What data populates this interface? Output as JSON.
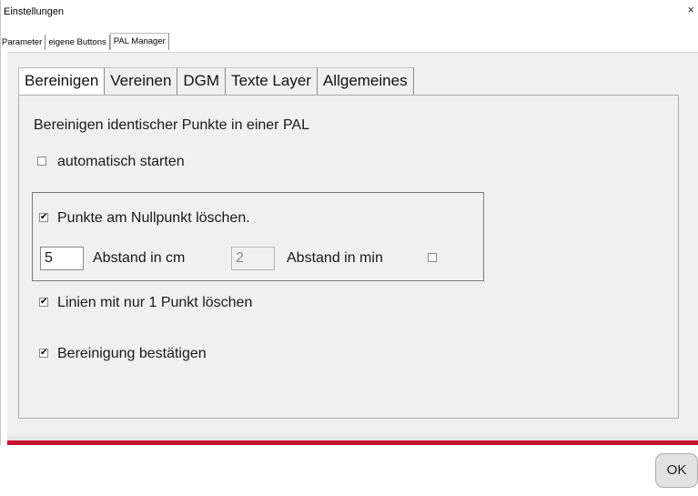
{
  "window": {
    "title": "Einstellungen",
    "close_glyph": "×"
  },
  "outer_tabs": [
    {
      "label": "Parameter",
      "active": false
    },
    {
      "label": "eigene Buttons",
      "active": false
    },
    {
      "label": "PAL Manager",
      "active": true
    }
  ],
  "inner_tabs": [
    {
      "label": "Bereinigen",
      "active": true
    },
    {
      "label": "Vereinen",
      "active": false
    },
    {
      "label": "DGM",
      "active": false
    },
    {
      "label": "Texte Layer",
      "active": false
    },
    {
      "label": "Allgemeines",
      "active": false
    }
  ],
  "content": {
    "heading": "Bereinigen identischer Punkte in einer PAL",
    "auto_start": {
      "label": "automatisch starten",
      "checked": false
    },
    "group": {
      "delete_zero": {
        "label": "Punkte am Nullpunkt löschen.",
        "checked": true
      },
      "distance_cm": {
        "value": "5",
        "label": "Abstand in cm"
      },
      "distance_min": {
        "value": "2",
        "label": "Abstand in min",
        "checked": false
      }
    },
    "lines_one_point": {
      "label": "Linien mit nur 1 Punkt löschen",
      "checked": true
    },
    "confirm_cleanup": {
      "label": "Bereinigung bestätigen",
      "checked": true
    }
  },
  "footer": {
    "ok_label": "OK"
  },
  "colors": {
    "accent_bar": "#c8102e",
    "panel_bg": "#f0f0f0"
  }
}
